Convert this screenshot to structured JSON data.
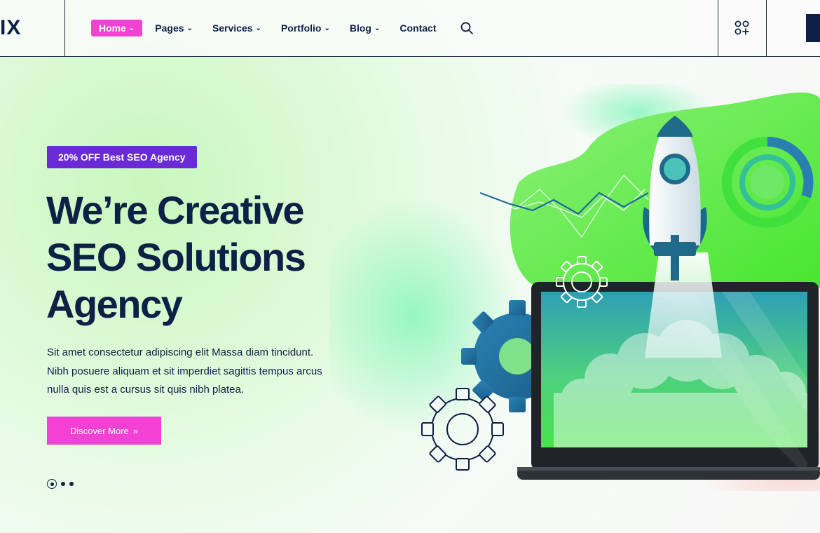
{
  "header": {
    "logo_text": "IX",
    "nav": [
      {
        "label": "Home",
        "active": true
      },
      {
        "label": "Pages"
      },
      {
        "label": "Services"
      },
      {
        "label": "Portfolio"
      },
      {
        "label": "Blog"
      },
      {
        "label": "Contact"
      }
    ],
    "icons": {
      "search": "search-icon",
      "apps": "apps-grid-icon",
      "dropdown": "chevron-down-icon"
    }
  },
  "hero": {
    "badge": "20% OFF Best SEO Agency",
    "headline_lines": [
      "We’re Creative",
      "SEO Solutions",
      "Agency"
    ],
    "description": "Sit amet consectetur adipiscing elit Massa diam tincidunt. Nibh posuere aliquam et sit imperdiet sagittis tempus arcus nulla quis est a cursus sit quis nibh platea.",
    "cta_label": "Discover More",
    "cta_icon": "double-chevron-right-icon",
    "slider": {
      "total": 3,
      "current": 1
    }
  },
  "colors": {
    "navy": "#0d2046",
    "pink": "#f241d3",
    "purple": "#6a2bd6",
    "green": "#5df04a",
    "teal": "#2f8fb0"
  }
}
